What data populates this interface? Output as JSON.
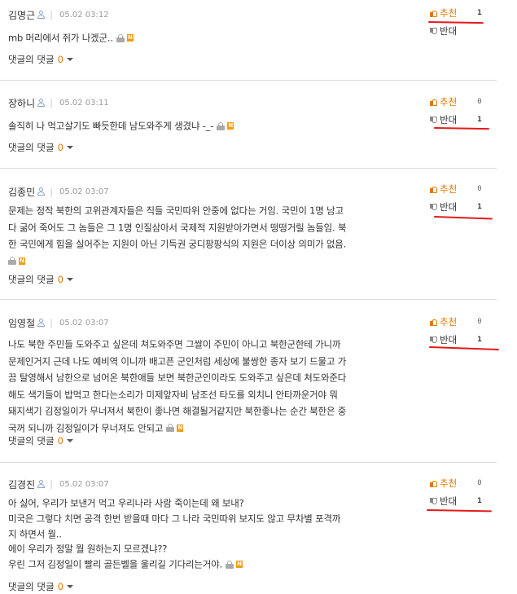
{
  "reply_label": "댓글의 댓글",
  "vote_up_label": "추천",
  "vote_down_label": "반대",
  "comments": [
    {
      "author": "김명근",
      "time": "05.02 03:12",
      "lines": [
        "mb 머리에서 쥐가 나겠군.."
      ],
      "reply_count": "0",
      "up_count": "1",
      "down_count": "",
      "highlighted": "up"
    },
    {
      "author": "장하니",
      "time": "05.02 03:11",
      "lines": [
        "솔직히 나 먹고살기도 빠듯한데 남도와주게 생겼냐 -_-"
      ],
      "reply_count": "0",
      "up_count": "0",
      "down_count": "1",
      "highlighted": "down"
    },
    {
      "author": "김종민",
      "time": "05.02 03:07",
      "lines": [
        "문제는 정작 북한의 고위관계자들은 직들 국민따위 안중에 없다는 거임. 국민이 1명 남고",
        "다 굶어 죽어도 그 놈들은 그 1명 인질삼아서 국제적 지원받아가면서 떵떵거릴 놈들임. 북",
        "한 국민에게 힘을 실어주는 지원이 아닌 기득권 궁디팡팡식의 지원은 더이상 의미가 없음."
      ],
      "reply_count": "0",
      "up_count": "0",
      "down_count": "1",
      "highlighted": "down"
    },
    {
      "author": "임영철",
      "time": "05.02 03:07",
      "lines": [
        "나도 북한 주민들 도와주고 싶은데 쳐도와주면 그쌀이 주민이 아니고 북한군한테 가니까",
        "문제인거지 근데 나도 예비역 이니까 배고픈 군인처럼 세상에 불쌍한 종자 보기 드물고 가",
        "끔 탈영해서 남한으로 넘어온 북한애들 보면 북한군인이라도 도와주고 싶은데 쳐도와준다",
        "해도 색기들이 밥먹고 한다는소리가 미제앞자비 남조선 타도를 외치니 안타까운거야 뭐",
        "돼지색기 김정일이가 무너져서 북한이 좋나면 해결될거같지만 북한좋나는 순간 북한은 중",
        "국꺼 되니까 김정일이가 무너져도 안되고"
      ],
      "reply_count": "0",
      "up_count": "0",
      "down_count": "1",
      "highlighted": "down"
    },
    {
      "author": "김경진",
      "time": "05.02 03:07",
      "lines": [
        "아 싫어, 우리가 보낸거 먹고 우리나라 사람 죽이는데 왜 보내?",
        "미국은 그렇다 치면 공격 한번 받을때 마다 그 나라 국민따위 보지도 않고 무차별 포격까",
        "지 하면서 뭘..",
        "에이 우리가 정말 뭘 원하는지 모르겠냐??",
        "우린 그저 김정일이 빨리 골든벨을 울리길 기다리는거야."
      ],
      "reply_count": "0",
      "up_count": "0",
      "down_count": "1",
      "highlighted": "down"
    }
  ]
}
